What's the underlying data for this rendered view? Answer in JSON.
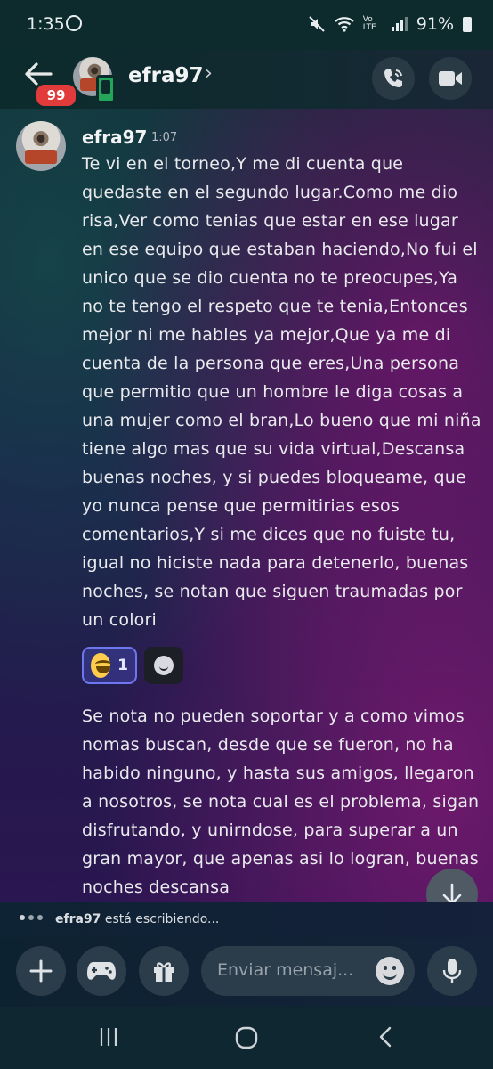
{
  "status_bar": {
    "time": "1:35",
    "network_label": "Vo LTE",
    "battery": "91%"
  },
  "header": {
    "unread_badge": "99",
    "username": "efra97",
    "chevron": "›"
  },
  "message": {
    "author": "efra97",
    "timestamp": "1:07",
    "text1": "Te vi en el torneo,Y me di cuenta que quedaste en el segundo lugar.Como me dio risa,Ver como tenias que estar en ese lugar en ese equipo que estaban haciendo,No fui el unico que se dio cuenta no te preocupes,Ya no te tengo el respeto que te tenia,Entonces mejor ni me hables ya mejor,Que ya me di cuenta de la persona que eres,Una persona que permitio que un hombre le diga cosas a una mujer como el bran,Lo bueno que mi niña tiene algo mas que su vida virtual,Descansa buenas noches, y si puedes bloqueame, que yo nunca pense que permitirias esos comentarios,Y si me dices que no fuiste tu, igual no hiciste nada para detenerlo, buenas noches, se notan que siguen traumadas por un colori",
    "reaction": {
      "emoji": "laughing-emoji",
      "count": "1"
    },
    "text2": "Se nota no pueden soportar y a como vimos nomas buscan, desde que se fueron, no ha habido ninguno, y hasta sus amigos, llegaron a nosotros, se nota cual es el problema, sigan disfrutando, y unirndose, para superar a un gran mayor, que apenas asi lo logran, buenas noches descansa"
  },
  "typing_indicator": {
    "user": "efra97",
    "text": "está escribiendo..."
  },
  "composer": {
    "placeholder": "Enviar mensaj..."
  },
  "colors": {
    "accent": "#5865f2",
    "badge": "#e23b3b",
    "online_mobile": "#23a55a"
  }
}
